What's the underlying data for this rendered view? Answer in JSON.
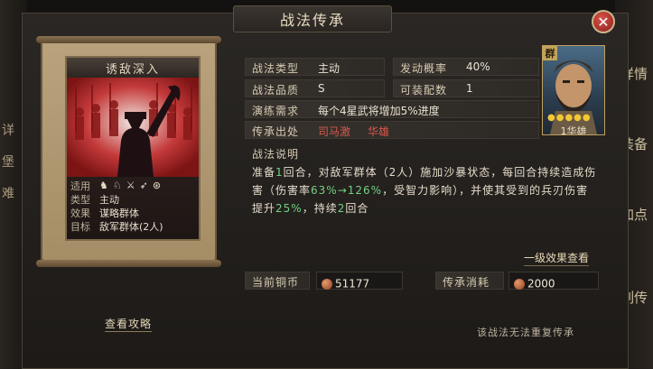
{
  "dialog": {
    "title": "战法传承",
    "close_glyph": "✕"
  },
  "side_tabs_right": [
    "详情",
    "装备",
    "加点",
    "列传"
  ],
  "side_tabs_left": [
    "详",
    "堡",
    "难"
  ],
  "card": {
    "name": "诱敌深入",
    "info": {
      "use_key": "适用",
      "use_icons": [
        "♞",
        "♘",
        "⚔",
        "➶",
        "⊛"
      ],
      "type_key": "类型",
      "type_val": "主动",
      "effect_key": "效果",
      "effect_val": "谋略群体",
      "target_key": "目标",
      "target_val": "敌军群体(2人)"
    }
  },
  "details": {
    "tactic_type_label": "战法类型",
    "tactic_type_value": "主动",
    "trigger_rate_label": "发动概率",
    "trigger_rate_value": "40%",
    "quality_label": "战法品质",
    "quality_value": "S",
    "slots_label": "可装配数",
    "slots_value": "1",
    "drill_label": "演练需求",
    "drill_value": "每个4星武将增加5%进度",
    "source_label": "传承出处",
    "source_1": "司马激",
    "source_2": "华雄"
  },
  "portrait": {
    "badge": "群",
    "stars": "●●●●●",
    "name": "1华雄"
  },
  "description": {
    "title": "战法说明",
    "p1": "准备",
    "p2": "1",
    "p3": "回合，对敌军群体（2人）施加沙暴状态，每回合持续造成伤害（伤害率",
    "p4": "63%",
    "p5": "→",
    "p6": "126%",
    "p7": "，受智力影响），并使其受到的兵刃伤害提升",
    "p8": "25%",
    "p9": "，持续",
    "p10": "2",
    "p11": "回合"
  },
  "effect_link": "一级效果查看",
  "copper": {
    "label": "当前铜币",
    "value": "51177"
  },
  "cost": {
    "label": "传承消耗",
    "value": "2000"
  },
  "guide_link": "查看攻略",
  "no_repeat": "该战法无法重复传承"
}
